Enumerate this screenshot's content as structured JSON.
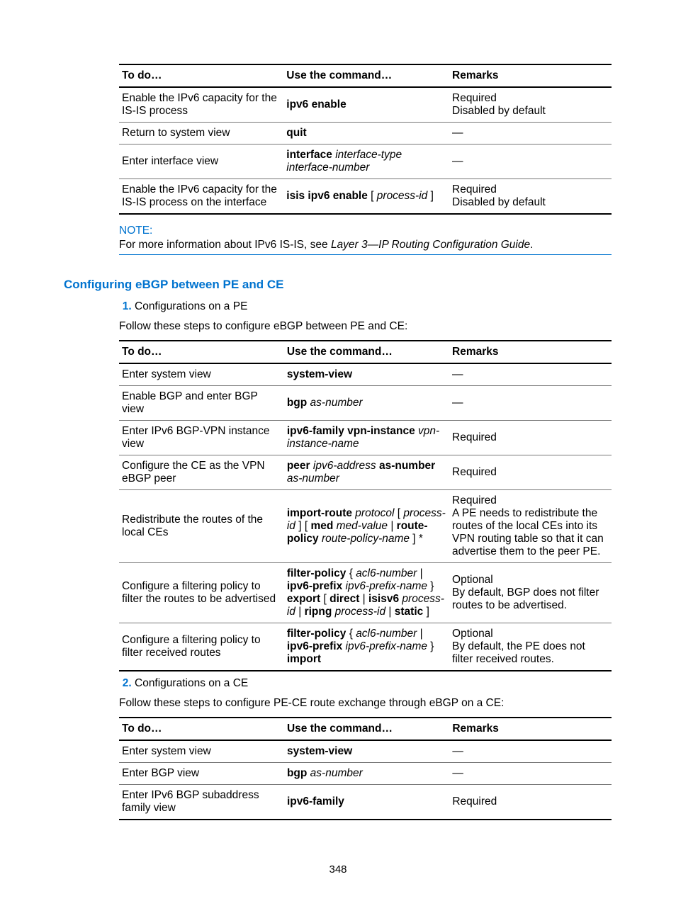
{
  "table1": {
    "headers": [
      "To do…",
      "Use the command…",
      "Remarks"
    ],
    "rows": [
      {
        "todo": "Enable the IPv6 capacity for the IS-IS process",
        "cmd_bold1": "ipv6 enable",
        "rem1": "Required",
        "rem2": "Disabled by default"
      },
      {
        "todo": "Return to system view",
        "cmd_bold1": "quit",
        "rem1": "—"
      },
      {
        "todo": "Enter interface view",
        "cmd_bold1": "interface",
        "cmd_it1": " interface-type interface-number",
        "rem1": "—"
      },
      {
        "todo": "Enable the IPv6 capacity for the IS-IS process on the interface",
        "cmd_bold1": "isis ipv6 enable",
        "cmd_plain1": " [ ",
        "cmd_it1": "process-id",
        "cmd_plain2": " ]",
        "rem1": "Required",
        "rem2": "Disabled by default"
      }
    ]
  },
  "note": {
    "heading": "NOTE:",
    "text_pre": "For more information about IPv6 IS-IS, see ",
    "text_it": "Layer 3—IP Routing Configuration Guide",
    "text_post": "."
  },
  "section_heading": "Configuring eBGP between PE and CE",
  "list1_item": "Configurations on a PE",
  "instr1": "Follow these steps to configure eBGP between PE and CE:",
  "table2": {
    "headers": [
      "To do…",
      "Use the command…",
      "Remarks"
    ],
    "rows": [
      {
        "todo": "Enter system view",
        "cmd_bold1": "system-view",
        "rem1": "—"
      },
      {
        "todo": "Enable BGP and enter BGP view",
        "cmd_bold1": "bgp",
        "cmd_it1": " as-number",
        "rem1": "—"
      },
      {
        "todo": "Enter IPv6 BGP-VPN instance view",
        "cmd_bold1": "ipv6-family vpn-instance",
        "cmd_it1": " vpn-instance-name",
        "rem1": "Required"
      },
      {
        "todo": "Configure the CE as the VPN eBGP peer",
        "cmd_bold1": "peer",
        "cmd_it1": " ipv6-address",
        "cmd_bold2": " as-number",
        "cmd_it2": " as-number",
        "rem1": "Required"
      },
      {
        "todo": "Redistribute the routes of the local CEs",
        "cmd_bold1": "import-route",
        "cmd_it1": " protocol",
        "cmd_plain1": " [ ",
        "cmd_it2": "process-id",
        "cmd_plain2": " ] [ ",
        "cmd_bold2": "med",
        "cmd_it3": " med-value",
        "cmd_plain3": " | ",
        "cmd_bold3": "route-policy",
        "cmd_it4": " route-policy-name",
        "cmd_plain4": " ] *",
        "rem1": "Required",
        "rem2": "A PE needs to redistribute the routes of the local CEs into its VPN routing table so that it can advertise them to the peer PE."
      },
      {
        "todo": "Configure a filtering policy to filter the routes to be advertised",
        "cmd_bold1": "filter-policy",
        "cmd_plain1": " { ",
        "cmd_it1": "acl6-number",
        "cmd_plain2": " | ",
        "cmd_bold2": "ipv6-prefix",
        "cmd_it2": " ipv6-prefix-name",
        "cmd_plain3": " } ",
        "cmd_bold3": "export",
        "cmd_plain4": " [ ",
        "cmd_bold4": "direct",
        "cmd_plain5": " | ",
        "cmd_bold5": "isisv6",
        "cmd_it3": " process-id",
        "cmd_plain6": " | ",
        "cmd_bold6": "ripng",
        "cmd_it4": " process-id",
        "cmd_plain7": " | ",
        "cmd_bold7": "static",
        "cmd_plain8": " ]",
        "rem1": "Optional",
        "rem2": "By default, BGP does not filter routes to be advertised."
      },
      {
        "todo": "Configure a filtering policy to filter received routes",
        "cmd_bold1": "filter-policy",
        "cmd_plain1": " { ",
        "cmd_it1": "acl6-number",
        "cmd_plain2": " | ",
        "cmd_bold2": "ipv6-prefix",
        "cmd_it2": " ipv6-prefix-name",
        "cmd_plain3": " } ",
        "cmd_bold3": "import",
        "rem1": "Optional",
        "rem2": "By default, the PE does not filter received routes."
      }
    ]
  },
  "list2_item": "Configurations on a CE",
  "instr2": "Follow these steps to configure PE-CE route exchange through eBGP on a CE:",
  "table3": {
    "headers": [
      "To do…",
      "Use the command…",
      "Remarks"
    ],
    "rows": [
      {
        "todo": "Enter system view",
        "cmd_bold1": "system-view",
        "rem1": "—"
      },
      {
        "todo": "Enter BGP view",
        "cmd_bold1": "bgp",
        "cmd_it1": " as-number",
        "rem1": "—"
      },
      {
        "todo": "Enter IPv6 BGP subaddress family view",
        "cmd_bold1": "ipv6-family",
        "rem1": "Required"
      }
    ]
  },
  "page_number": "348"
}
